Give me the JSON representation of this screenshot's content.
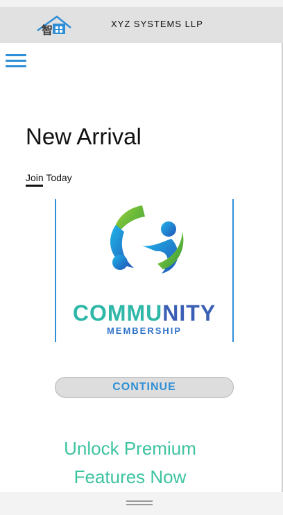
{
  "header": {
    "brand": "XYZ SYSTEMS LLP",
    "logo_icon": "house-icon",
    "logo_glyph": "智"
  },
  "nav": {
    "menu_icon": "hamburger-menu-icon"
  },
  "hero": {
    "title": "New Arrival",
    "subtitle": "Join Today"
  },
  "card": {
    "title_part1": "COMMU",
    "title_part2": "NITY",
    "subtitle": "MEMBERSHIP",
    "art_icon": "community-people-icon"
  },
  "actions": {
    "continue_label": "CONTINUE"
  },
  "promo": {
    "line1": "Unlock Premium",
    "line2": "Features Now"
  },
  "colors": {
    "accent_blue": "#2f8fd6",
    "accent_teal": "#3ec3a1",
    "header_bg": "#e1e1e1"
  }
}
